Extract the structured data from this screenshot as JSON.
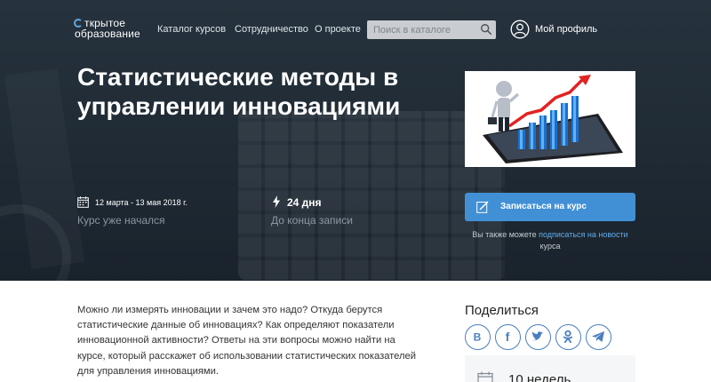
{
  "nav": {
    "logo_line1": "ткрытое",
    "logo_line2": "образование",
    "links": [
      "Каталог курсов",
      "Сотрудничество",
      "О проекте"
    ],
    "search_placeholder": "Поиск в каталоге",
    "profile_label": "Мой профиль"
  },
  "hero": {
    "title": "Статистические методы в управлении инновациями",
    "dates": "12 марта - 13 мая 2018 г.",
    "status": "Курс уже начался",
    "days": "24 дня",
    "deadline": "До конца записи",
    "enroll_label": "Записаться на курс",
    "sub_note_before": "Вы также можете ",
    "sub_note_link": "подписаться на новости",
    "sub_note_after": " курса"
  },
  "main": {
    "description": "Можно ли измерять инновации и зачем это надо? Откуда берутся статистические данные об инновациях? Как определяют показатели инновационной активности? Ответы на эти вопросы можно найти на курсе, который расскажет об использовании статистических показателей для управления инновациями."
  },
  "sidebar": {
    "share_title": "Поделиться",
    "socials": [
      "vk-icon",
      "facebook-icon",
      "twitter-icon",
      "odnoklassniki-icon",
      "telegram-icon"
    ],
    "duration": "10 недель"
  },
  "colors": {
    "accent": "#4190d6",
    "hero_bg": "#232e38",
    "link": "#62acea",
    "social_border": "#4b7ec0"
  }
}
